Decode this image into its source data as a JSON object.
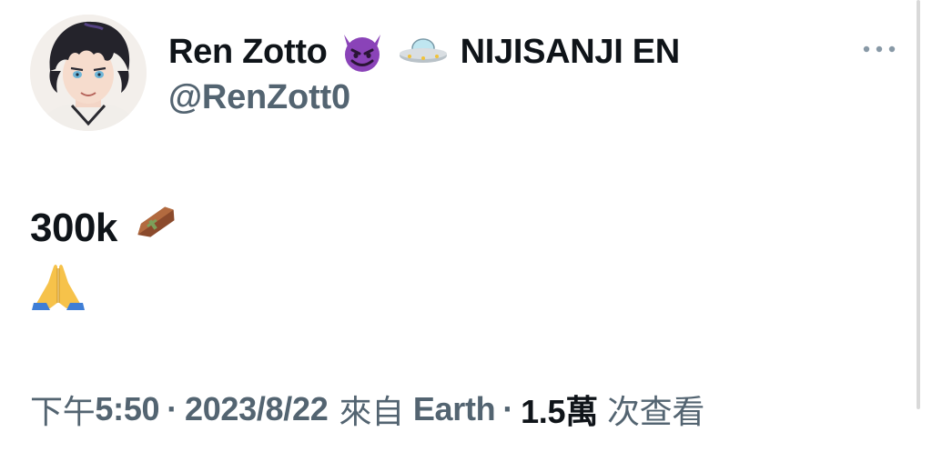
{
  "author": {
    "display_name": "Ren Zotto",
    "affiliation": "NIJISANJI EN",
    "handle": "@RenZott0",
    "name_emojis": [
      "smiling-imp-icon",
      "flying-saucer-icon"
    ],
    "avatar": "avatar"
  },
  "tweet": {
    "line1_text": "300k",
    "line1_emoji": "coffin-icon",
    "line2_emoji": "folded-hands-icon"
  },
  "meta": {
    "time_prefix": "下午",
    "time": "5:50",
    "separator": "·",
    "date": "2023/8/22",
    "source_prefix": "來自",
    "source": "Earth",
    "views_count": "1.5萬",
    "views_label": "次查看"
  },
  "more_icon": "more-horizontal-icon",
  "colors": {
    "text_primary": "#0f1419",
    "text_secondary": "#536471",
    "background": "#ffffff"
  }
}
